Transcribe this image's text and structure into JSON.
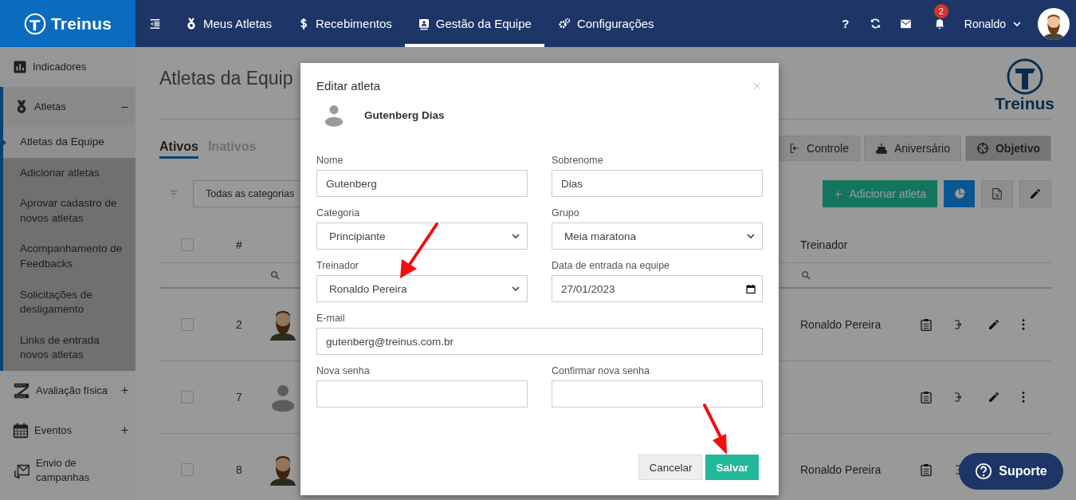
{
  "topbar": {
    "logo": "Treinus",
    "nav": [
      {
        "label": "Meus Atletas",
        "selected": false
      },
      {
        "label": "Recebimentos",
        "selected": false
      },
      {
        "label": "Gestão da Equipe",
        "selected": true
      },
      {
        "label": "Configurações",
        "selected": false
      }
    ],
    "help": "?",
    "notification_count": "2",
    "user": "Ronaldo"
  },
  "sidebar": {
    "items": [
      {
        "label": "Indicadores"
      },
      {
        "label": "Atletas",
        "expanded": true,
        "children": [
          {
            "label": "Atletas da Equipe",
            "selected": true
          },
          {
            "label": "Adicionar atletas",
            "selected": false
          },
          {
            "label": "Aprovar cadastro de novos atletas",
            "selected": false
          },
          {
            "label": "Acompanhamento de Feedbacks",
            "selected": false
          },
          {
            "label": "Solicitações de desligamento",
            "selected": false
          },
          {
            "label": "Links de entrada novos atletas",
            "selected": false
          }
        ]
      },
      {
        "label": "Avaliação física",
        "expanded": false
      },
      {
        "label": "Eventos",
        "expanded": false
      },
      {
        "label": "Envio de campanhas"
      }
    ]
  },
  "page": {
    "title": "Atletas da Equip",
    "logo": "Treinus",
    "tabs": [
      {
        "label": "Ativos",
        "selected": true
      },
      {
        "label": "Inativos",
        "selected": false
      }
    ],
    "view_buttons": [
      {
        "label": "Controle",
        "selected": false
      },
      {
        "label": "Aniversário",
        "selected": false
      },
      {
        "label": "Objetivo",
        "selected": true
      }
    ],
    "category_filter": "Todas as categorias",
    "add_button": "Adicionar atleta",
    "table": {
      "header_checked": false,
      "number_heading": "#",
      "coach_heading": "Treinador",
      "rows": [
        {
          "kind": "photo",
          "checked": false,
          "number": "2",
          "coach": "Ronaldo Pereira"
        },
        {
          "kind": "placeholder",
          "checked": false,
          "number": "7"
        },
        {
          "kind": "photo",
          "checked": false,
          "number": "8",
          "coach": "Ronaldo Pereira"
        }
      ]
    }
  },
  "modal": {
    "title": "Editar atleta",
    "athlete_name": "Gutenberg Dias",
    "fields": [
      {
        "label": "Nome",
        "kind": "text",
        "value": "Gutenberg"
      },
      {
        "label": "Sobrenome",
        "kind": "text",
        "value": "Dias"
      },
      {
        "label": "Categoria",
        "kind": "select",
        "value": "Principiante"
      },
      {
        "label": "Grupo",
        "kind": "select",
        "value": "Meia maratona"
      },
      {
        "label": "Treinador",
        "kind": "select",
        "value": "Ronaldo Pereira"
      },
      {
        "label": "Data de entrada na equipe",
        "kind": "date",
        "value": "27/01/2023"
      },
      {
        "label": "E-mail",
        "kind": "email",
        "value": "gutenberg@treinus.com.br"
      },
      {
        "label": "Nova senha",
        "kind": "password"
      },
      {
        "label": "Confirmar nova senha",
        "kind": "password"
      }
    ],
    "buttons": [
      {
        "label": "Cancelar",
        "kind": "secondary"
      },
      {
        "label": "Salvar",
        "kind": "primary"
      }
    ]
  },
  "support_button": "Suporte"
}
